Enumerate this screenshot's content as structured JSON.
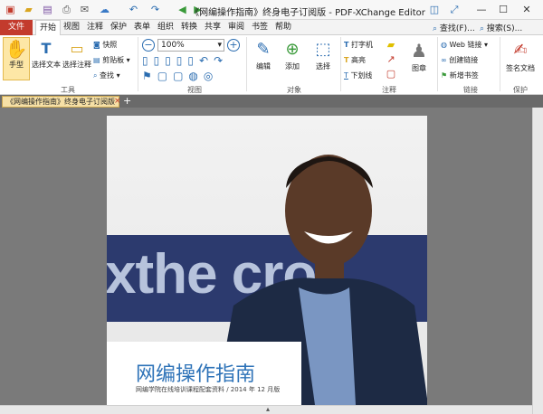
{
  "window": {
    "title": "《网编操作指南》终身电子订阅版 - PDF-XChange Editor"
  },
  "quick_access": {
    "icons": [
      "app-icon",
      "open-icon",
      "save-icon",
      "print-icon",
      "email-icon",
      "cloud-icon",
      "undo-icon",
      "redo-icon",
      "back-icon",
      "forward-icon"
    ]
  },
  "menu": {
    "file": "文件",
    "items": [
      "开始",
      "视图",
      "注释",
      "保护",
      "表单",
      "组织",
      "转换",
      "共享",
      "审阅",
      "书签",
      "帮助"
    ]
  },
  "search": {
    "find_label": "查找(F)...",
    "search_label": "搜索(S)..."
  },
  "ribbon": {
    "tools": {
      "hand": "手型",
      "select_text": "选择文本",
      "select_comment": "选择注释",
      "snapshot": "快照",
      "clipboard": "剪贴板",
      "find": "查找",
      "group": "工具"
    },
    "view": {
      "zoom": "100%",
      "group": "视图"
    },
    "objects": {
      "edit": "编辑",
      "add": "添加",
      "select": "选择",
      "group": "对象"
    },
    "comments": {
      "typewriter": "打字机",
      "highlight": "高亮",
      "underline": "下划线",
      "stamp": "图章",
      "group": "注释"
    },
    "links": {
      "web_link": "Web 链接",
      "create_link": "创建链接",
      "new_bookmark": "新增书签",
      "group": "链接"
    },
    "protect": {
      "sign": "签名文档",
      "group": "保护"
    }
  },
  "tab": {
    "doc_name": "《网编操作指南》终身电子订阅版",
    "close": "×",
    "add": "+"
  },
  "document": {
    "banner_text": "xthe    cro",
    "caption_title": "网编操作指南",
    "caption_sub": "网编学院在线培训课程配套资料 / 2014 年 12 月版"
  },
  "colors": {
    "file_menu": "#c33b2d",
    "accent_blue": "#2e73b8",
    "doc_tab": "#f6e0a6",
    "banner": "#2c3a6e"
  }
}
